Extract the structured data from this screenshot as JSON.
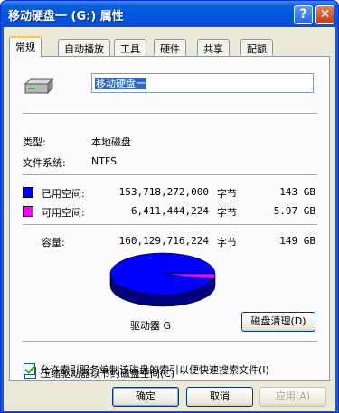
{
  "window": {
    "title": "移动硬盘一 (G:) 属性"
  },
  "titlebar": {
    "help_glyph": "?",
    "close_glyph": "✕"
  },
  "tabs": [
    {
      "label": "常规"
    },
    {
      "label": "自动播放"
    },
    {
      "label": "工具"
    },
    {
      "label": "硬件"
    },
    {
      "label": "共享"
    },
    {
      "label": "配额"
    }
  ],
  "general": {
    "drive_name": "移动硬盘一",
    "type_label": "类型:",
    "type_value": "本地磁盘",
    "fs_label": "文件系统:",
    "fs_value": "NTFS",
    "used": {
      "label": "已用空间:",
      "bytes": "153,718,272,000",
      "unit": "字节",
      "size": "143 GB",
      "color": "#0000ff"
    },
    "free": {
      "label": "可用空间:",
      "bytes": "6,411,444,224",
      "unit": "字节",
      "size": "5.97 GB",
      "color": "#ff00ff"
    },
    "capacity": {
      "label": "容量:",
      "bytes": "160,129,716,224",
      "unit": "字节",
      "size": "149 GB"
    },
    "drive_label": "驱动器 G",
    "cleanup_button": "磁盘清理(D)",
    "compress_label": "压缩驱动器以节约磁盘空间(C)",
    "compress_checked": false,
    "index_label": "允许索引服务编制该磁盘的索引以便快速搜索文件(I)",
    "index_checked": true
  },
  "chart_data": {
    "type": "pie",
    "categories": [
      "已用空间",
      "可用空间"
    ],
    "values": [
      153718272000,
      6411444224
    ],
    "colors": [
      "#0000ff",
      "#ff00ff"
    ]
  },
  "footer": {
    "ok": "确定",
    "cancel": "取消",
    "apply": "应用(A)"
  }
}
